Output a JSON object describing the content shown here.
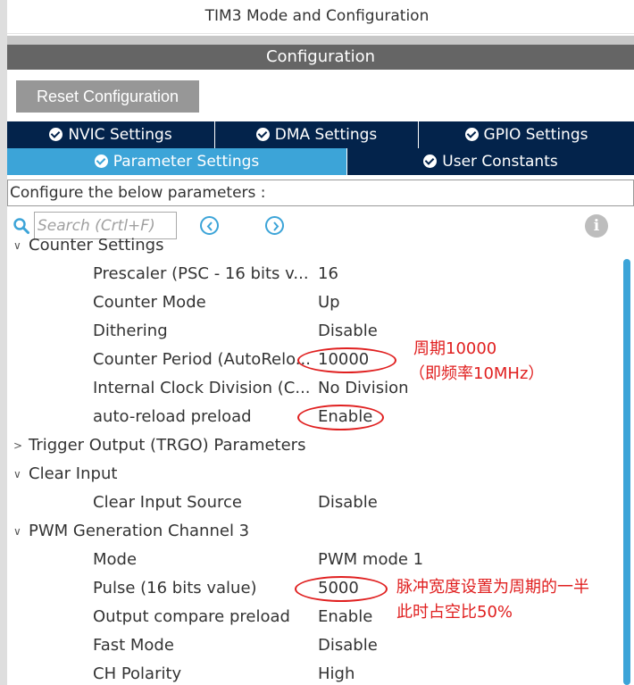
{
  "window": {
    "title": "TIM3 Mode and Configuration"
  },
  "config_header": "Configuration",
  "reset_button": "Reset Configuration",
  "tabs_row1": [
    {
      "label": "NVIC Settings"
    },
    {
      "label": "DMA Settings"
    },
    {
      "label": "GPIO Settings"
    }
  ],
  "tabs_row2": [
    {
      "label": "Parameter Settings",
      "active": true
    },
    {
      "label": "User Constants"
    }
  ],
  "description": "Configure the below parameters :",
  "search": {
    "placeholder": "Search (Crtl+F)"
  },
  "tree": {
    "counter_settings": {
      "label": "Counter Settings",
      "params": [
        {
          "name": "Prescaler (PSC - 16 bits v...",
          "value": "16"
        },
        {
          "name": "Counter Mode",
          "value": "Up"
        },
        {
          "name": "Dithering",
          "value": "Disable"
        },
        {
          "name": "Counter Period (AutoRelo...",
          "value": "10000"
        },
        {
          "name": "Internal Clock Division (C...",
          "value": "No Division"
        },
        {
          "name": "auto-reload preload",
          "value": "Enable"
        }
      ]
    },
    "trigger_output": {
      "label": "Trigger Output (TRGO) Parameters"
    },
    "clear_input": {
      "label": "Clear Input",
      "params": [
        {
          "name": "Clear Input Source",
          "value": "Disable"
        }
      ]
    },
    "pwm_channel3": {
      "label": "PWM Generation Channel 3",
      "params": [
        {
          "name": "Mode",
          "value": "PWM mode 1"
        },
        {
          "name": "Pulse (16 bits value)",
          "value": "5000"
        },
        {
          "name": "Output compare preload",
          "value": "Enable"
        },
        {
          "name": "Fast Mode",
          "value": "Disable"
        },
        {
          "name": "CH Polarity",
          "value": "High"
        }
      ]
    }
  },
  "annotations": {
    "period_line1": "周期10000",
    "period_line2": "（即频率10MHz）",
    "pulse_line1": "脉冲宽度设置为周期的一半",
    "pulse_line2": "此时占空比50%"
  },
  "colors": {
    "tab_dark": "#03234b",
    "tab_active": "#3ca4d8",
    "annotation_red": "#e02020"
  }
}
